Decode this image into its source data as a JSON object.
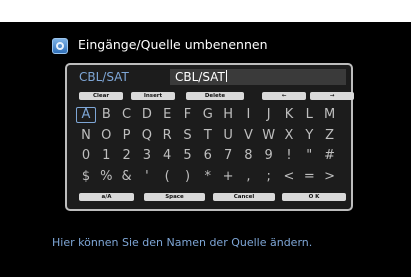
{
  "title": "Eingänge/Quelle umbenennen",
  "source_label": "CBL/SAT",
  "name_value": "CBL/SAT",
  "function_buttons": [
    "Clear",
    "Insert",
    "Delete",
    "←",
    "→"
  ],
  "keyboard_rows": [
    [
      "A",
      "B",
      "C",
      "D",
      "E",
      "F",
      "G",
      "H",
      "I",
      "J",
      "K",
      "L",
      "M"
    ],
    [
      "N",
      "O",
      "P",
      "Q",
      "R",
      "S",
      "T",
      "U",
      "V",
      "W",
      "X",
      "Y",
      "Z"
    ],
    [
      "0",
      "1",
      "2",
      "3",
      "4",
      "5",
      "6",
      "7",
      "8",
      "9",
      "!",
      "\"",
      "#"
    ],
    [
      "$",
      "%",
      "&",
      "'",
      "(",
      ")",
      "*",
      "+",
      ",",
      ";",
      "<",
      "=",
      ">"
    ]
  ],
  "selected_key": "A",
  "bottom_buttons": [
    "a/A",
    "Space",
    "Cancel",
    "O K"
  ],
  "hint": "Hier können Sie den Namen der Quelle ändern."
}
